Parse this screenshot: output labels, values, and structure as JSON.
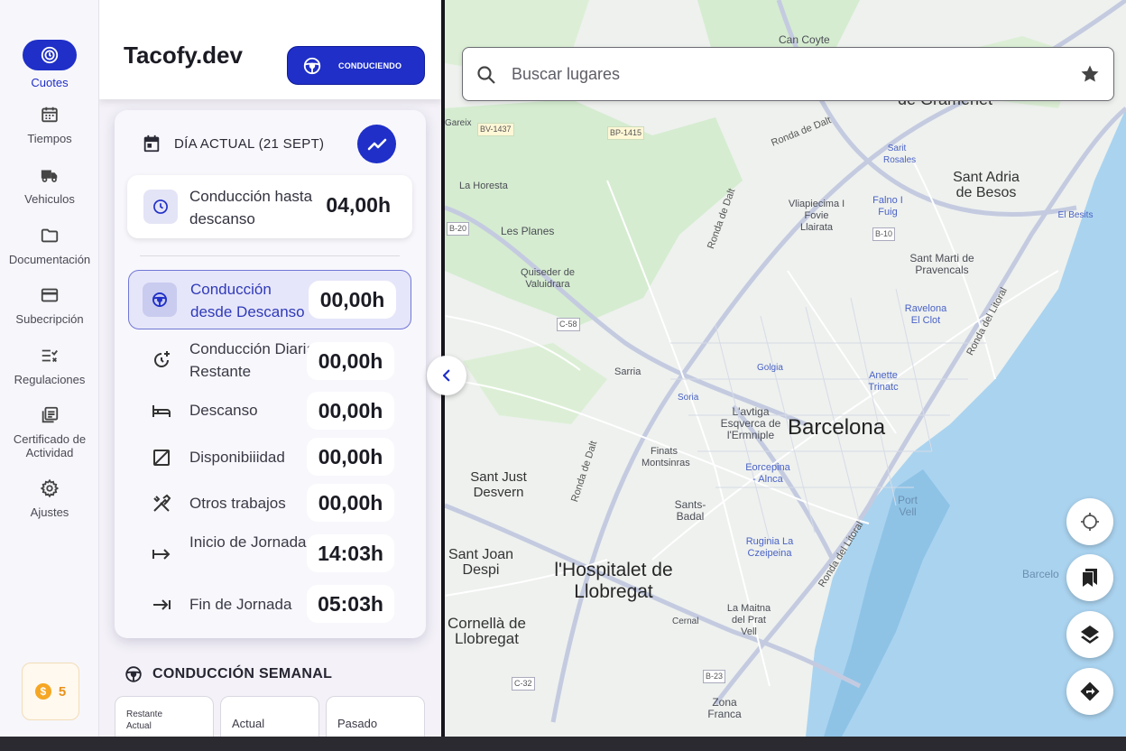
{
  "nav": {
    "items": [
      {
        "label": "Cuotes",
        "icon": "clock-icon",
        "active": true
      },
      {
        "label": "Tiempos",
        "icon": "calendar-icon"
      },
      {
        "label": "Vehiculos",
        "icon": "truck-icon"
      },
      {
        "label": "Documentación",
        "icon": "folder-icon"
      },
      {
        "label": "Subecripción",
        "icon": "credit-card-icon"
      },
      {
        "label": "Regulaciones",
        "icon": "checklist-icon"
      },
      {
        "label": "Certificado de Actividad",
        "icon": "certificate-icon"
      },
      {
        "label": "Ajustes",
        "icon": "gear-icon"
      }
    ],
    "coins": "5"
  },
  "header": {
    "title": "Tacofy.dev",
    "mode_button": "CONDUCIENDO"
  },
  "today": {
    "title": "DÍA ACTUAL (21 SEPT)",
    "highlight": {
      "label": "Conducción hasta descanso",
      "value": "04,00h"
    },
    "active": {
      "label": "Conducción desde Descanso",
      "value": "00,00h"
    },
    "rows": [
      {
        "label": "Conducción Diaria Restante",
        "value": "00,00h"
      },
      {
        "label": "Descanso",
        "value": "00,00h"
      },
      {
        "label": "Disponibiiidad",
        "value": "00,00h"
      },
      {
        "label": "Otros trabajos",
        "value": "00,00h"
      },
      {
        "label": "Inicio de Jornada",
        "value": "14:03h"
      },
      {
        "label": "Fin de Jornada",
        "value": "05:03h"
      }
    ]
  },
  "weekly": {
    "title": "CONDUCCIÓN SEMANAL",
    "boxes": [
      "Restante Actual",
      "Actual",
      "Pasado"
    ]
  },
  "map": {
    "search_placeholder": "Buscar lugares",
    "colors": {
      "water": "#aad3ef",
      "park": "#cfe9c9",
      "road": "#ffffff",
      "major_road": "#c4cbe0",
      "accent": "#1f2fc8"
    },
    "labels": {
      "barcelona": "Barcelona",
      "hospitalet": "l'Hospitalet de Llobregat",
      "cornella": "Cornellà de Llobregat",
      "sant_joan": "Sant Joan Despi",
      "sant_just": "Sant Just Desvern",
      "gramenet": "de Gramenet",
      "sant_adria": "Sant Adria de Besos",
      "can_coyte": "Can Coyte",
      "les_planes": "Les Planes",
      "quisedor": "Quiseder de Valuidrara",
      "sarria": "Sarria",
      "soria": "Soria",
      "eixample": "L'avtiga Esqverca de l'Ermniple",
      "finats": "Finats Montsinras",
      "sants": "Sants-Badal",
      "ruginia": "Ruginia La Czeipeina",
      "maitna": "La Maitna del Prat Vell",
      "zona_franca": "Zona Franca",
      "cernal": "Cernal",
      "golgia": "Golgia",
      "encorpina": "Eorcepina - Alnca",
      "anette": "Anette Trinatc",
      "villapiecima": "Vliapiecima I Fovie Llairata",
      "falno": "Falno I Fuig",
      "sarit": "Sarit Rosales",
      "sant_marti": "Sant Marti de Pravencals",
      "ravelona": "Ravelona El Clot",
      "la_horesta": "La Horesta",
      "gareix": "Gareix",
      "port_vell": "Port Vell",
      "barcelona_sea": "Barcelo",
      "besits": "El Besits",
      "ronda_dalt": "Ronda de Dalt",
      "ronda_litoral": "Ronda del Litoral",
      "ronda_dalt_2": "Ronda de Dalt",
      "ronda_litoral_2": "Ronda del Litoral",
      "b20": "B-20",
      "bv1437": "BV-1437",
      "bp1415": "BP-1415",
      "b10": "B-10",
      "c58": "C-58",
      "c32": "C-32",
      "b23": "B-23"
    }
  }
}
